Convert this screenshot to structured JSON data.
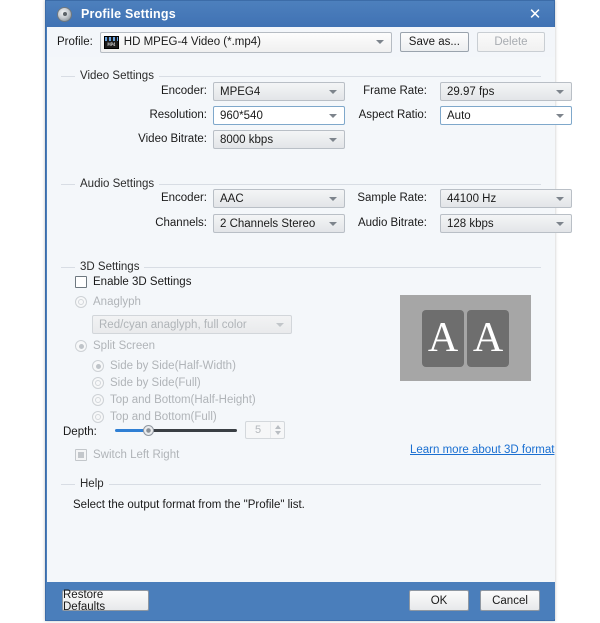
{
  "window": {
    "title": "Profile Settings",
    "icon": "disc-icon",
    "close_label": "✕",
    "accent_color": "#4a7ebb",
    "titlebar_color": "#4072b4",
    "content_bg": "#f4f7fa"
  },
  "profile_bar": {
    "label": "Profile:",
    "icon": "mp4-film-icon",
    "value": "HD MPEG-4 Video (*.mp4)",
    "save_as_label": "Save as...",
    "delete_label": "Delete",
    "delete_disabled": true
  },
  "video_settings": {
    "title": "Video Settings",
    "fields": [
      {
        "label": "Encoder:",
        "value": "MPEG4",
        "style": "dropdown"
      },
      {
        "label": "Resolution:",
        "value": "960*540",
        "style": "editable"
      },
      {
        "label": "Video Bitrate:",
        "value": "8000 kbps",
        "style": "dropdown"
      },
      {
        "label": "Frame Rate:",
        "value": "29.97 fps",
        "style": "dropdown"
      },
      {
        "label": "Aspect Ratio:",
        "value": "Auto",
        "style": "editable"
      }
    ]
  },
  "audio_settings": {
    "title": "Audio Settings",
    "fields": [
      {
        "label": "Encoder:",
        "value": "AAC",
        "style": "dropdown"
      },
      {
        "label": "Channels:",
        "value": "2 Channels Stereo",
        "style": "dropdown"
      },
      {
        "label": "Sample Rate:",
        "value": "44100 Hz",
        "style": "dropdown"
      },
      {
        "label": "Audio Bitrate:",
        "value": "128 kbps",
        "style": "dropdown"
      }
    ]
  },
  "settings_3d": {
    "title": "3D Settings",
    "enable_label": "Enable 3D Settings",
    "enable_checked": false,
    "anaglyph_label": "Anaglyph",
    "anaglyph_selected": false,
    "anaglyph_value": "Red/cyan anaglyph, full color",
    "split_screen_label": "Split Screen",
    "split_screen_selected": true,
    "split_options": [
      {
        "label": "Side by Side(Half-Width)",
        "selected": true
      },
      {
        "label": "Side by Side(Full)",
        "selected": false
      },
      {
        "label": "Top and Bottom(Half-Height)",
        "selected": false
      },
      {
        "label": "Top and Bottom(Full)",
        "selected": false
      }
    ],
    "depth_label": "Depth:",
    "depth_value": "5",
    "depth_percent": 28,
    "switch_lr_label": "Switch Left Right",
    "switch_lr_checked": true,
    "preview_left_glyph": "A",
    "preview_right_glyph": "A",
    "learn_more_label": "Learn more about 3D format",
    "link_color": "#1a6fd1"
  },
  "help": {
    "title": "Help",
    "text": "Select the output format from the \"Profile\" list."
  },
  "footer": {
    "restore_label": "Restore Defaults",
    "ok_label": "OK",
    "cancel_label": "Cancel"
  }
}
